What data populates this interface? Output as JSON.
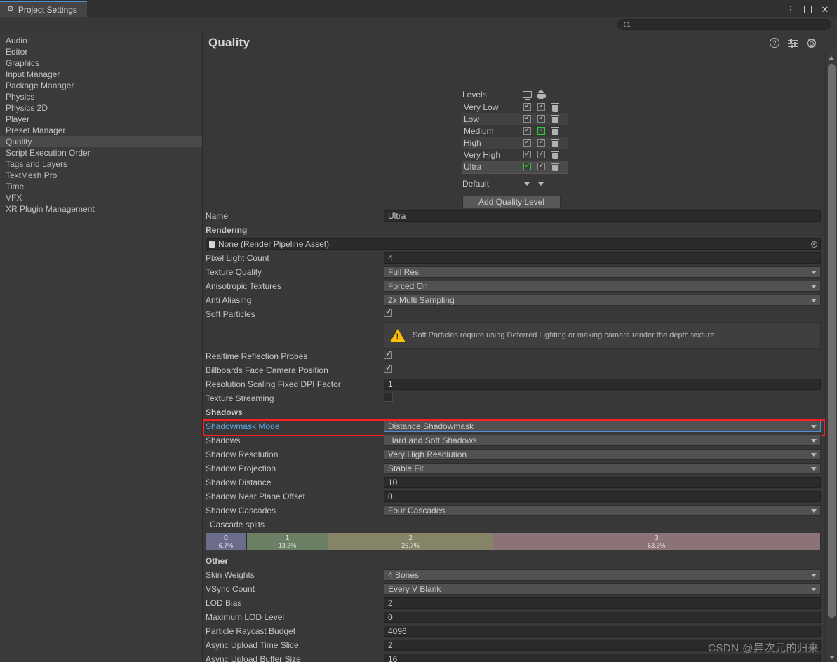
{
  "window": {
    "tab_label": "Project Settings",
    "tab_icon": "gear-icon",
    "menu_icon": "kebab-menu-icon",
    "maximize_icon": "maximize-icon",
    "close_icon": "close-icon"
  },
  "search": {
    "value": "",
    "placeholder": ""
  },
  "sidebar": {
    "items": [
      {
        "label": "Audio",
        "selected": false
      },
      {
        "label": "Editor",
        "selected": false
      },
      {
        "label": "Graphics",
        "selected": false
      },
      {
        "label": "Input Manager",
        "selected": false
      },
      {
        "label": "Package Manager",
        "selected": false
      },
      {
        "label": "Physics",
        "selected": false
      },
      {
        "label": "Physics 2D",
        "selected": false
      },
      {
        "label": "Player",
        "selected": false
      },
      {
        "label": "Preset Manager",
        "selected": false
      },
      {
        "label": "Quality",
        "selected": true
      },
      {
        "label": "Script Execution Order",
        "selected": false
      },
      {
        "label": "Tags and Layers",
        "selected": false
      },
      {
        "label": "TextMesh Pro",
        "selected": false
      },
      {
        "label": "Time",
        "selected": false
      },
      {
        "label": "VFX",
        "selected": false
      },
      {
        "label": "XR Plugin Management",
        "selected": false
      }
    ]
  },
  "panel": {
    "title": "Quality",
    "help_icon": "help-icon",
    "presets_icon": "presets-sliders-icon",
    "settings_icon": "gear-icon"
  },
  "levels": {
    "header_label": "Levels",
    "platform_icons": [
      "desktop-monitor-icon",
      "android-icon"
    ],
    "rows": [
      {
        "name": "Very Low",
        "desktop": true,
        "android": true,
        "desktop_green": false,
        "android_green": false,
        "selected": false
      },
      {
        "name": "Low",
        "desktop": true,
        "android": true,
        "desktop_green": false,
        "android_green": false,
        "selected": false
      },
      {
        "name": "Medium",
        "desktop": true,
        "android": true,
        "desktop_green": false,
        "android_green": true,
        "selected": false
      },
      {
        "name": "High",
        "desktop": true,
        "android": true,
        "desktop_green": false,
        "android_green": false,
        "selected": false
      },
      {
        "name": "Very High",
        "desktop": true,
        "android": true,
        "desktop_green": false,
        "android_green": false,
        "selected": false
      },
      {
        "name": "Ultra",
        "desktop": true,
        "android": true,
        "desktop_green": true,
        "android_green": false,
        "selected": true
      }
    ],
    "default_label": "Default",
    "add_button_label": "Add Quality Level"
  },
  "properties": {
    "name_label": "Name",
    "name_value": "Ultra",
    "rendering_section": "Rendering",
    "render_pipeline_asset": "None (Render Pipeline Asset)",
    "rendering_rows": [
      {
        "label": "Pixel Light Count",
        "type": "text",
        "value": "4"
      },
      {
        "label": "Texture Quality",
        "type": "dropdown",
        "value": "Full Res"
      },
      {
        "label": "Anisotropic Textures",
        "type": "dropdown",
        "value": "Forced On"
      },
      {
        "label": "Anti Aliasing",
        "type": "dropdown",
        "value": "2x Multi Sampling"
      },
      {
        "label": "Soft Particles",
        "type": "checkbox",
        "checked": true
      }
    ],
    "warning_text": "Soft Particles require using Deferred Lighting or making camera render the depth texture.",
    "rendering_rows_2": [
      {
        "label": "Realtime Reflection Probes",
        "type": "checkbox",
        "checked": true
      },
      {
        "label": "Billboards Face Camera Position",
        "type": "checkbox",
        "checked": true
      },
      {
        "label": "Resolution Scaling Fixed DPI Factor",
        "type": "text",
        "value": "1"
      },
      {
        "label": "Texture Streaming",
        "type": "checkbox-dark",
        "checked": false
      }
    ],
    "shadows_section": "Shadows",
    "shadowmask_row": {
      "label": "Shadowmask Mode",
      "value": "Distance Shadowmask",
      "highlighted": true
    },
    "shadow_rows": [
      {
        "label": "Shadows",
        "type": "dropdown",
        "value": "Hard and Soft Shadows"
      },
      {
        "label": "Shadow Resolution",
        "type": "dropdown",
        "value": "Very High Resolution"
      },
      {
        "label": "Shadow Projection",
        "type": "dropdown",
        "value": "Stable Fit"
      },
      {
        "label": "Shadow Distance",
        "type": "text",
        "value": "10"
      },
      {
        "label": "Shadow Near Plane Offset",
        "type": "text",
        "value": "0"
      },
      {
        "label": "Shadow Cascades",
        "type": "dropdown",
        "value": "Four Cascades"
      }
    ],
    "cascade_splits_label": "Cascade splits",
    "cascades": [
      {
        "index": "0",
        "percent": "6.7%",
        "width": 6.7,
        "color": "#6c6c8c"
      },
      {
        "index": "1",
        "percent": "13.3%",
        "width": 13.3,
        "color": "#6b7f64"
      },
      {
        "index": "2",
        "percent": "26.7%",
        "width": 26.7,
        "color": "#868466"
      },
      {
        "index": "3",
        "percent": "53.3%",
        "width": 53.3,
        "color": "#8c7377"
      }
    ],
    "other_section": "Other",
    "other_rows": [
      {
        "label": "Skin Weights",
        "type": "dropdown",
        "value": "4 Bones"
      },
      {
        "label": "VSync Count",
        "type": "dropdown",
        "value": "Every V Blank"
      },
      {
        "label": "LOD Bias",
        "type": "text",
        "value": "2"
      },
      {
        "label": "Maximum LOD Level",
        "type": "text",
        "value": "0"
      },
      {
        "label": "Particle Raycast Budget",
        "type": "text",
        "value": "4096"
      },
      {
        "label": "Async Upload Time Slice",
        "type": "text",
        "value": "2"
      },
      {
        "label": "Async Upload Buffer Size",
        "type": "text",
        "value": "16"
      }
    ]
  },
  "watermark": "CSDN @异次元的归来",
  "colors": {
    "accent_blue": "#4a90d9",
    "highlight_red": "#ff1f1f",
    "green_check": "#2ecc2e",
    "warning_yellow": "#ffc008"
  }
}
